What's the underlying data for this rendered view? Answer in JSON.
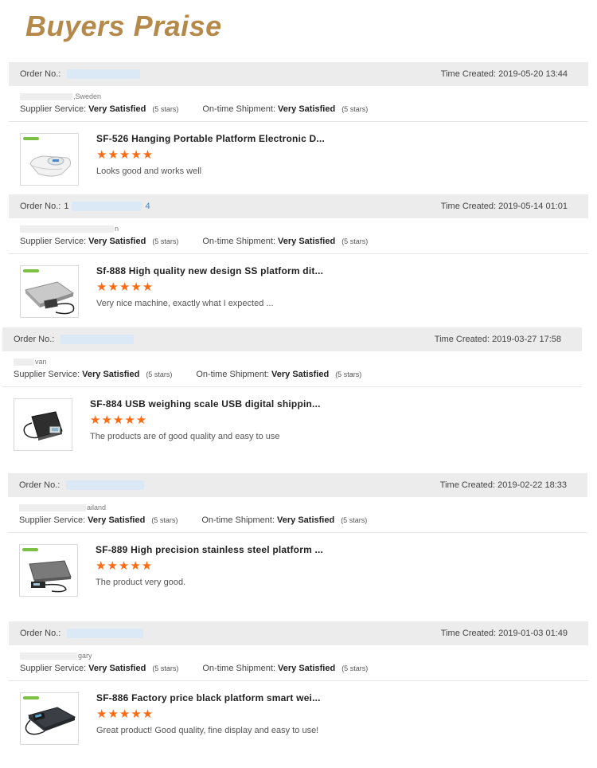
{
  "header": {
    "title": "Buyers Praise"
  },
  "labels": {
    "order_no": "Order No.:",
    "time_created": "Time Created:",
    "supplier_service": "Supplier Service:",
    "ontime_shipment": "On-time Shipment:",
    "very_satisfied": "Very Satisfied",
    "five_stars": "(5 stars)",
    "star_glyphs": "★★★★★"
  },
  "reviews": [
    {
      "order_prefix": "",
      "order_suffix": "",
      "time": "2019-05-20 13:44",
      "buyer_suffix": ",Sweden",
      "product_title": "SF-526 Hanging Portable Platform Electronic D...",
      "rating": 5,
      "comment": "Looks good and works well",
      "thumb_icon": "white-hanging-scale-icon"
    },
    {
      "order_prefix": "1",
      "order_suffix": "4",
      "time": "2019-05-14 01:01",
      "buyer_suffix": "n",
      "product_title": "Sf-888 High quality new design SS platform dit...",
      "rating": 5,
      "comment": "Very nice machine, exactly what I expected ...",
      "thumb_icon": "silver-platform-scale-icon"
    },
    {
      "order_prefix": "",
      "order_suffix": "",
      "time": "2019-03-27 17:58",
      "buyer_suffix": "van",
      "product_title": "SF-884 USB weighing scale USB digital shippin...",
      "rating": 5,
      "comment": "The products are of good quality and easy to use",
      "thumb_icon": "usb-shipping-scale-icon"
    },
    {
      "order_prefix": "",
      "order_suffix": "",
      "time": "2019-02-22 18:33",
      "buyer_suffix": "ailand",
      "product_title": "SF-889 High precision stainless steel platform ...",
      "rating": 5,
      "comment": "The product very good.",
      "thumb_icon": "stainless-platform-scale-icon"
    },
    {
      "order_prefix": "",
      "order_suffix": "",
      "time": "2019-01-03 01:49",
      "buyer_suffix": "gary",
      "product_title": "SF-886 Factory price black platform smart wei...",
      "rating": 5,
      "comment": "Great product! Good quality, fine display and easy to use!",
      "thumb_icon": "black-platform-scale-icon"
    }
  ]
}
